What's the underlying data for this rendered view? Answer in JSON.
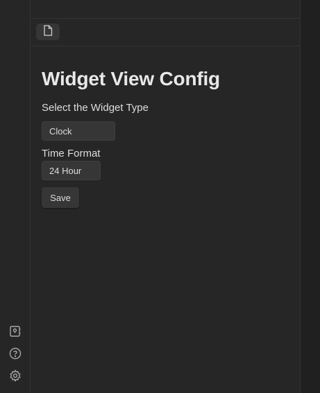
{
  "tab": {
    "icon": "file-icon"
  },
  "config": {
    "title": "Widget View Config",
    "widget_type_label": "Select the Widget Type",
    "widget_type_value": "Clock",
    "time_format_label": "Time Format",
    "time_format_value": "24 Hour",
    "save_label": "Save"
  },
  "ribbon": {
    "icons": [
      "vault-icon",
      "help-icon",
      "settings-icon"
    ]
  }
}
